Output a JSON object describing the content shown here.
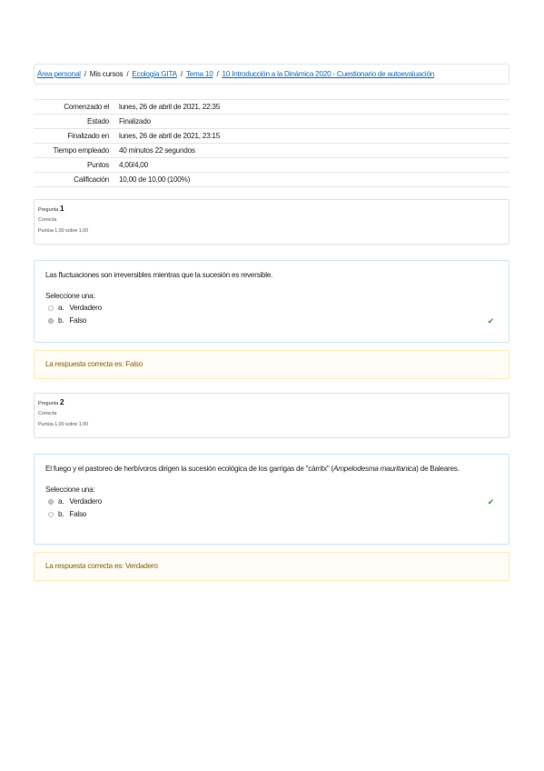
{
  "breadcrumb": {
    "area": "Área personal",
    "mis_cursos": "Mis cursos",
    "curso": "Ecología GITA",
    "tema": "Tema 10",
    "cuestionario": "10 Introducción a la Dinámica 2020 - Cuestionario de autoevaluación"
  },
  "summary": [
    {
      "label": "Comenzado el",
      "value": "lunes, 26 de abril de 2021, 22:35"
    },
    {
      "label": "Estado",
      "value": "Finalizado"
    },
    {
      "label": "Finalizado en",
      "value": "lunes, 26 de abril de 2021, 23:15"
    },
    {
      "label": "Tiempo empleado",
      "value": "40 minutos 22 segundos"
    },
    {
      "label": "Puntos",
      "value": "4,00/4,00"
    },
    {
      "label": "Calificación",
      "value": "10,00 de 10,00 (100%)"
    }
  ],
  "questions": [
    {
      "label": "Pregunta",
      "number": "1",
      "status": "Correcta",
      "score": "Puntúa 1,00 sobre 1,00",
      "text": "Las fluctuaciones son irreversibles mientras que la sucesión es reversible.",
      "prompt": "Seleccione una:",
      "options": [
        {
          "letter": "a.",
          "label": "Verdadero",
          "selected": false
        },
        {
          "letter": "b.",
          "label": "Falso",
          "selected": true
        }
      ],
      "feedback": "La respuesta correcta es: Falso"
    },
    {
      "label": "Pregunta",
      "number": "2",
      "status": "Correcta",
      "score": "Puntúa 1,00 sobre 1,00",
      "text_before": "El fuego y el pastoreo de herbívoros dirigen la sucesión ecológica de los garrigas de \"càrritx\" (",
      "text_italic": "Ampelodesma mauritanica",
      "text_after": ") de Baleares.",
      "prompt": "Seleccione una:",
      "options": [
        {
          "letter": "a.",
          "label": "Verdadero",
          "selected": true
        },
        {
          "letter": "b.",
          "label": "Falso",
          "selected": false
        }
      ],
      "feedback": "La respuesta correcta es: Verdadero"
    }
  ],
  "icons": {
    "check": "check-icon",
    "radio": "radio-icon"
  },
  "colors": {
    "link": "#0f6cbf",
    "correct": "#3a9a3a",
    "feedback_text": "#8a5e08",
    "feedback_bg": "#fffdf6"
  }
}
